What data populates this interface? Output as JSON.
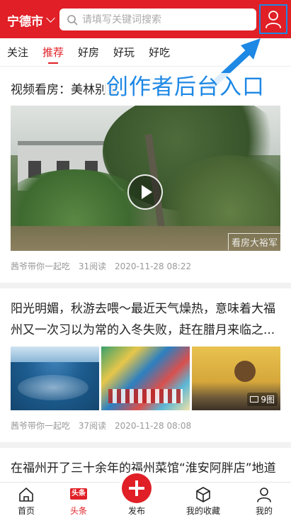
{
  "header": {
    "city": "宁德市",
    "search_placeholder": "请填写关键词搜索",
    "search_icon": "search-icon",
    "user_icon": "user-icon"
  },
  "annotation": {
    "text": "创作者后台入口",
    "color": "#1e88e5"
  },
  "tabs": [
    {
      "label": "关注",
      "active": false
    },
    {
      "label": "推荐",
      "active": true
    },
    {
      "label": "好房",
      "active": false
    },
    {
      "label": "好玩",
      "active": false
    },
    {
      "label": "好吃",
      "active": false
    }
  ],
  "feed": {
    "article1": {
      "title": "视频看房：美林别墅",
      "video_watermark": "看房大裕军",
      "author": "茜爷带你一起吃",
      "reads": "31阅读",
      "time": "2020-11-28 08:22"
    },
    "article2": {
      "title": "阳光明媚，秋游去喂～最近天气燥热，意味着大福州又一次习以为常的入冬失败，赶在腊月来临之...",
      "image_count": "9图",
      "author": "茜爷带你一起吃",
      "reads": "37阅读",
      "time": "2020-11-28 08:08"
    },
    "article3": {
      "title": "在福州开了三十余年的福州菜馆“淮安阿胖店”地道好吃又经典"
    }
  },
  "bottom_nav": {
    "home": "首页",
    "toutiao_badge": "头条",
    "toutiao": "头条",
    "publish": "发布",
    "favorites": "我的收藏",
    "mine": "我的"
  },
  "colors": {
    "brand_red": "#e01f26",
    "annotation_blue": "#1e88e5"
  }
}
